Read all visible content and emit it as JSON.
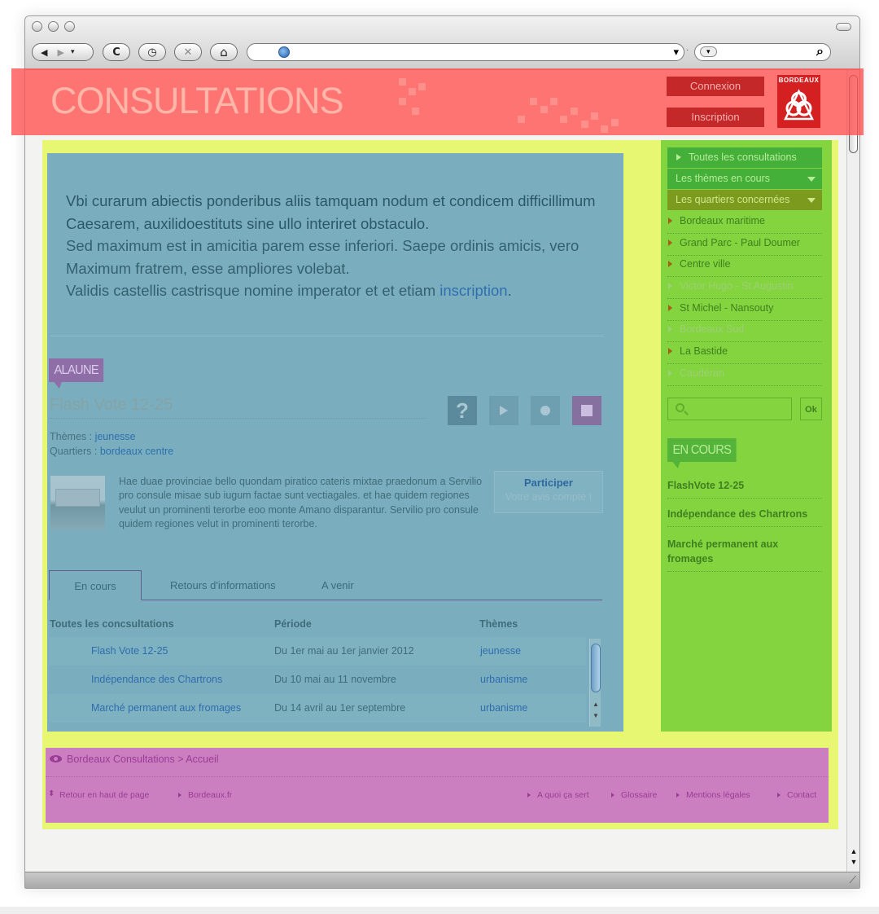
{
  "browser": {
    "back_icon": "◀",
    "forward_icon": "▶",
    "reload_icon": "C",
    "history_icon": "◷",
    "stop_icon": "✕",
    "home_icon": "⌂",
    "url_dropdown_icon": "▾",
    "search_icon": "⌕"
  },
  "header": {
    "title": "CONSULTATIONS",
    "login_label": "Connexion",
    "register_label": "Inscription",
    "logo_text": "BORDEAUX"
  },
  "intro": {
    "line_bold_1": "Vbi curarum abiectis ponderibus aliis tamquam nodum et condicem difficillimum Caesarem, auxilidoestituts sine ullo interiret obstaculo.",
    "line_2": "Sed maximum est in amicitia parem esse inferiori. Saepe ordinis amicis, vero Maximum fratrem, esse ampliores volebat.",
    "line_3": "Validis castellis castrisque nomine imperator et et etiam",
    "link": "inscription",
    "period": "."
  },
  "featured": {
    "tag": "ALAUNE",
    "title": "Flash Vote 12-25",
    "themes_label": "Thèmes : ",
    "themes_value": "jeunesse",
    "districts_label": "Quartiers : ",
    "districts_value": "bordeaux centre",
    "teaser": "Hae duae provinciae bello quondam piratico cateris mixtae praedonum a Servilio pro consule misae sub iugum factae sunt vectiagales. et hae quidem regiones veulut un prominenti terorbe eoo monte Amano disparantur. Servilio pro consule quidem regiones velut in prominenti terorbe.",
    "participate_title": "Participer",
    "participate_sub": "Votre avis compte !",
    "help_icon": "?"
  },
  "tabs": [
    {
      "label": "En cours"
    },
    {
      "label": "Retours d'informations"
    },
    {
      "label": "A venir"
    }
  ],
  "table": {
    "headers": [
      "Toutes les concsultations",
      "Période",
      "Thèmes"
    ],
    "rows": [
      {
        "name": "Flash Vote 12-25",
        "period": "Du 1er mai au 1er janvier 2012",
        "theme": "jeunesse"
      },
      {
        "name": "Indépendance des Chartrons",
        "period": "Du 10 mai au 11 novembre",
        "theme": "urbanisme"
      },
      {
        "name": "Marché permanent aux fromages",
        "period": "Du 14 avril au 1er septembre",
        "theme": "urbanisme"
      }
    ]
  },
  "sidebar": {
    "all_label": "Toutes les consultations",
    "themes_label": "Les thèmes en cours",
    "districts_label": "Les quartiers concernées",
    "districts": [
      {
        "label": "Bordeaux maritime",
        "active": true
      },
      {
        "label": "Grand Parc - Paul Doumer",
        "active": true
      },
      {
        "label": "Centre ville",
        "active": true
      },
      {
        "label": "Victor Hugo - St Augustin",
        "active": false
      },
      {
        "label": "St Michel - Nansouty",
        "active": true
      },
      {
        "label": "Bordeaux Sud",
        "active": false
      },
      {
        "label": "La Bastide",
        "active": true
      },
      {
        "label": "Caudéran",
        "active": false
      }
    ],
    "search_ok": "Ok",
    "en_cours_tag": "EN COURS",
    "en_cours": [
      {
        "label": "FlashVote 12-25"
      },
      {
        "label": "Indépendance des Chartrons"
      },
      {
        "label": "Marché permanent aux fromages"
      }
    ]
  },
  "footer": {
    "breadcrumb": "Bordeaux Consultations > Accueil",
    "back_to_top": "Retour en haut de page",
    "bordeaux_link": "Bordeaux.fr",
    "about": "A quoi ça sert",
    "glossary": "Glossaire",
    "legal": "Mentions légales",
    "contact": "Contact"
  },
  "colors": {
    "header": "#ff5050",
    "content_bg": "#e7f772",
    "main": "#7aaebe",
    "sidebar": "#84d43f",
    "footer": "#cc7fc0"
  }
}
